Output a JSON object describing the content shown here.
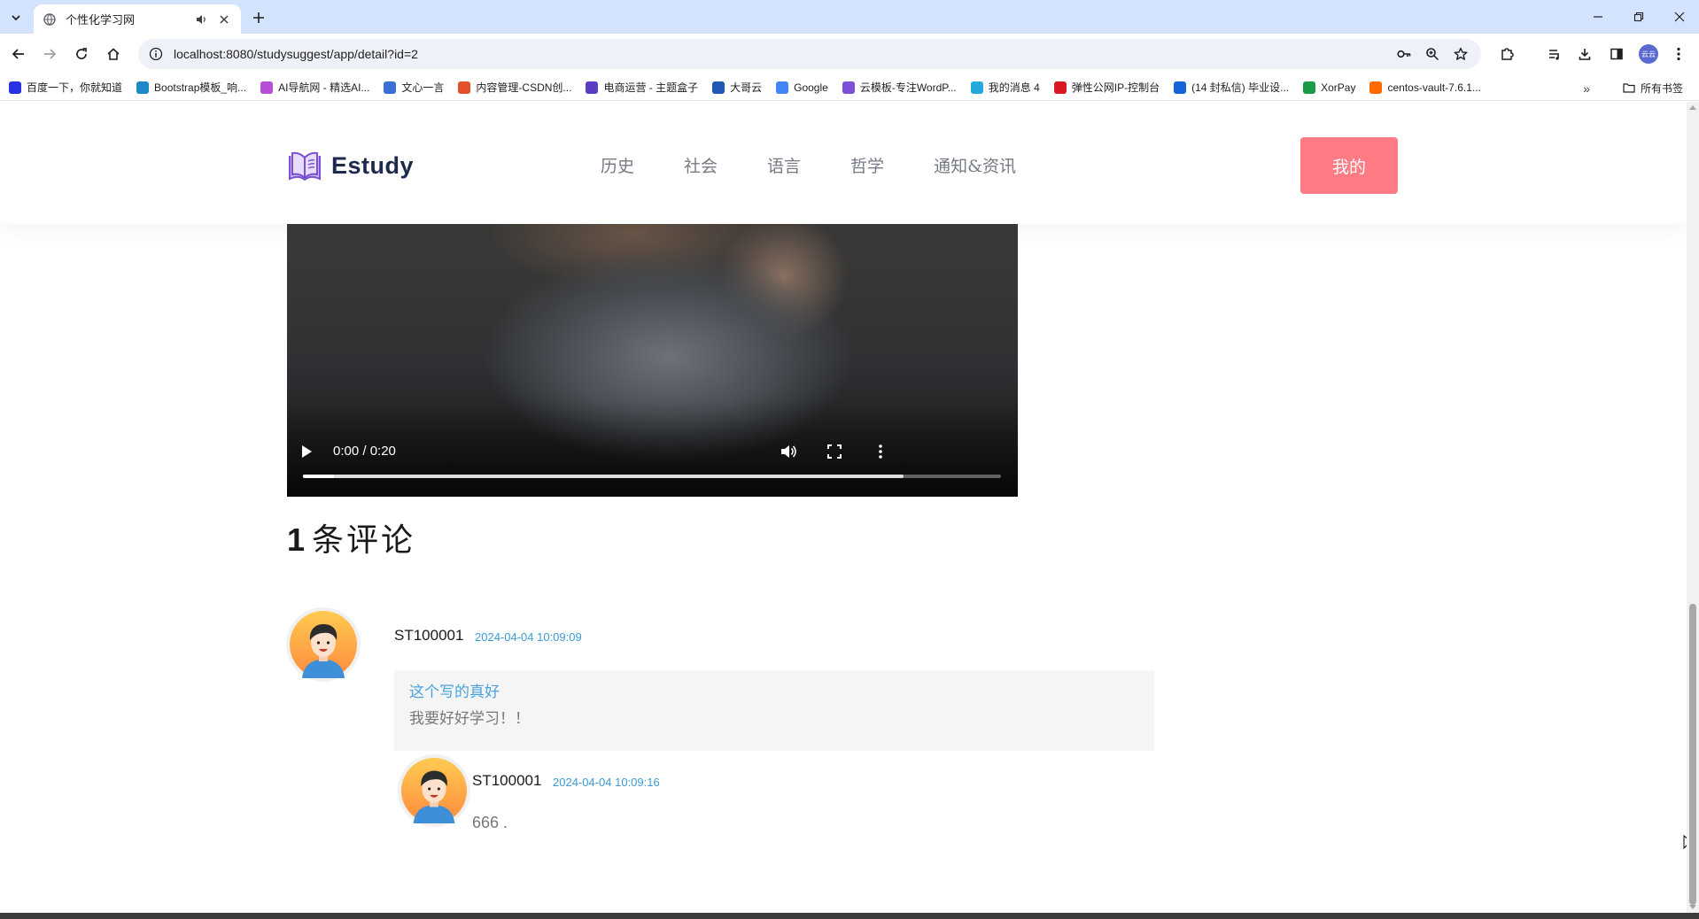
{
  "browser": {
    "tab_title": "个性化学习网",
    "url": "localhost:8080/studysuggest/app/detail?id=2",
    "bookmarks": [
      {
        "label": "百度一下，你就知道",
        "icon": "baidu-icon",
        "color": "#2932e1"
      },
      {
        "label": "Bootstrap模板_响...",
        "icon": "bootstrap-icon",
        "color": "#1e88c8"
      },
      {
        "label": "AI导航网 - 精选AI...",
        "icon": "ai-nav-icon",
        "color": "#b44fd6"
      },
      {
        "label": "文心一言",
        "icon": "wenxin-icon",
        "color": "#3a6fd8"
      },
      {
        "label": "内容管理-CSDN创...",
        "icon": "csdn-icon",
        "color": "#e2512c"
      },
      {
        "label": "电商运营 - 主题盒子",
        "icon": "theme-box-icon",
        "color": "#5b3cc4"
      },
      {
        "label": "大哥云",
        "icon": "dagecloud-icon",
        "color": "#2456b8"
      },
      {
        "label": "Google",
        "icon": "google-icon",
        "color": "#4285f4"
      },
      {
        "label": "云模板-专注WordP...",
        "icon": "cloud-template-icon",
        "color": "#7b4fd6"
      },
      {
        "label": "我的消息 4",
        "icon": "bilibili-icon",
        "color": "#23a9dc"
      },
      {
        "label": "弹性公网IP-控制台",
        "icon": "huawei-icon",
        "color": "#d71a21"
      },
      {
        "label": "(14 封私信) 毕业设...",
        "icon": "zhihu-icon",
        "color": "#1466d8"
      },
      {
        "label": "XorPay",
        "icon": "xorpay-icon",
        "color": "#1b9b48"
      },
      {
        "label": "centos-vault-7.6.1...",
        "icon": "aliyun-icon",
        "color": "#ff6a00"
      }
    ],
    "all_bookmarks_label": "所有书签",
    "profile_label": "云云"
  },
  "site": {
    "logo_text": "Estudy",
    "nav": [
      "历史",
      "社会",
      "语言",
      "哲学",
      "通知&资讯"
    ],
    "mine_button": "我的",
    "accent_color": "#ff7b84"
  },
  "video": {
    "time": "0:00 / 0:20",
    "loaded_fraction": 0.86,
    "played_fraction": 0.045
  },
  "comments": {
    "count": "1",
    "title_label": "条评论",
    "items": [
      {
        "user": "ST100001",
        "time": "2024-04-04 10:09:09",
        "line1": "这个写的真好",
        "line2": "我要好好学习！！",
        "reply": {
          "user": "ST100001",
          "time": "2024-04-04 10:09:16",
          "text": "666 ."
        }
      }
    ]
  }
}
